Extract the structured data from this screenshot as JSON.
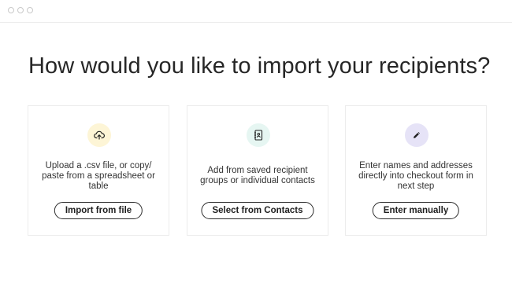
{
  "heading": "How would you like to import your recipients?",
  "options": [
    {
      "icon": "cloud-upload-icon",
      "icon_bg": "#fdf5d6",
      "description": "Upload a .csv file, or copy/ paste from a spreadsheet or table",
      "button_label": "Import from file"
    },
    {
      "icon": "address-book-icon",
      "icon_bg": "#e6f6f2",
      "description": "Add from saved recipient groups or individual contacts",
      "button_label": "Select from Contacts"
    },
    {
      "icon": "pencil-icon",
      "icon_bg": "#e6e3f7",
      "description": "Enter names and addresses directly into checkout form in next step",
      "button_label": "Enter manually"
    }
  ]
}
